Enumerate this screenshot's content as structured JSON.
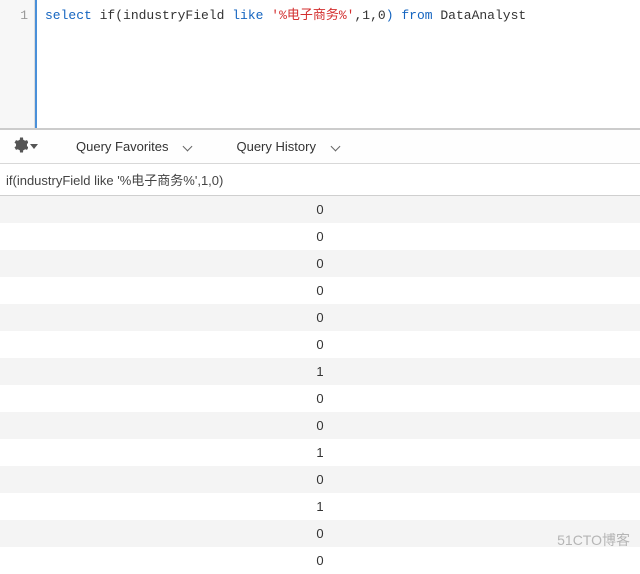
{
  "editor": {
    "line_no": "1",
    "tokens": {
      "select": "select",
      "if_open": " if(industryField ",
      "like": "like",
      "sp1": " ",
      "str": "'%电子商务%'",
      "args": ",1,0",
      "paren_close": ")",
      "sp2": " ",
      "from": "from",
      "table": " DataAnalyst"
    }
  },
  "toolbar": {
    "favorites_label": "Query Favorites",
    "history_label": "Query History"
  },
  "results": {
    "column_header": "if(industryField like '%电子商务%',1,0)",
    "rows": [
      "0",
      "0",
      "0",
      "0",
      "0",
      "0",
      "1",
      "0",
      "0",
      "1",
      "0",
      "1",
      "0",
      "0"
    ]
  },
  "watermark": "51CTO博客"
}
